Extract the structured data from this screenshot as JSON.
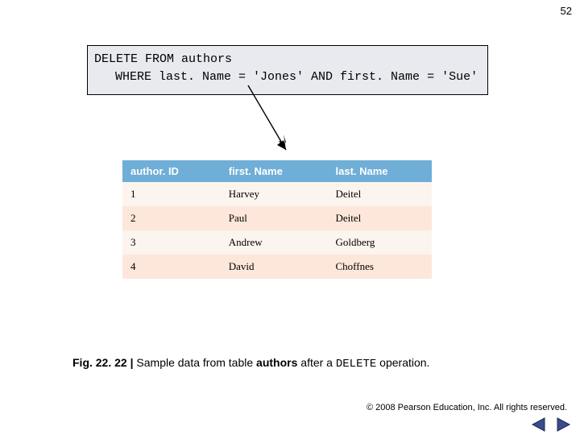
{
  "page_number": "52",
  "sql": {
    "line1": "DELETE FROM authors",
    "line2": "WHERE last. Name = 'Jones' AND first. Name = 'Sue'"
  },
  "table": {
    "headers": {
      "c1": "author. ID",
      "c2": "first. Name",
      "c3": "last. Name"
    },
    "rows": [
      {
        "id": "1",
        "first": "Harvey",
        "last": "Deitel"
      },
      {
        "id": "2",
        "first": "Paul",
        "last": "Deitel"
      },
      {
        "id": "3",
        "first": "Andrew",
        "last": "Goldberg"
      },
      {
        "id": "4",
        "first": "David",
        "last": "Choffnes"
      }
    ]
  },
  "caption": {
    "fig": "Fig. 22. 22 | ",
    "t1": "Sample data from table ",
    "table_name": "authors",
    "t2": " after a ",
    "op": "DELETE",
    "t3": " operation."
  },
  "copyright": "© 2008 Pearson Education, Inc. All rights reserved.",
  "colors": {
    "header_bg": "#6faed6",
    "row_odd": "#fcf4ee",
    "row_even": "#fde7da",
    "sql_bg": "#e8eaf0"
  }
}
